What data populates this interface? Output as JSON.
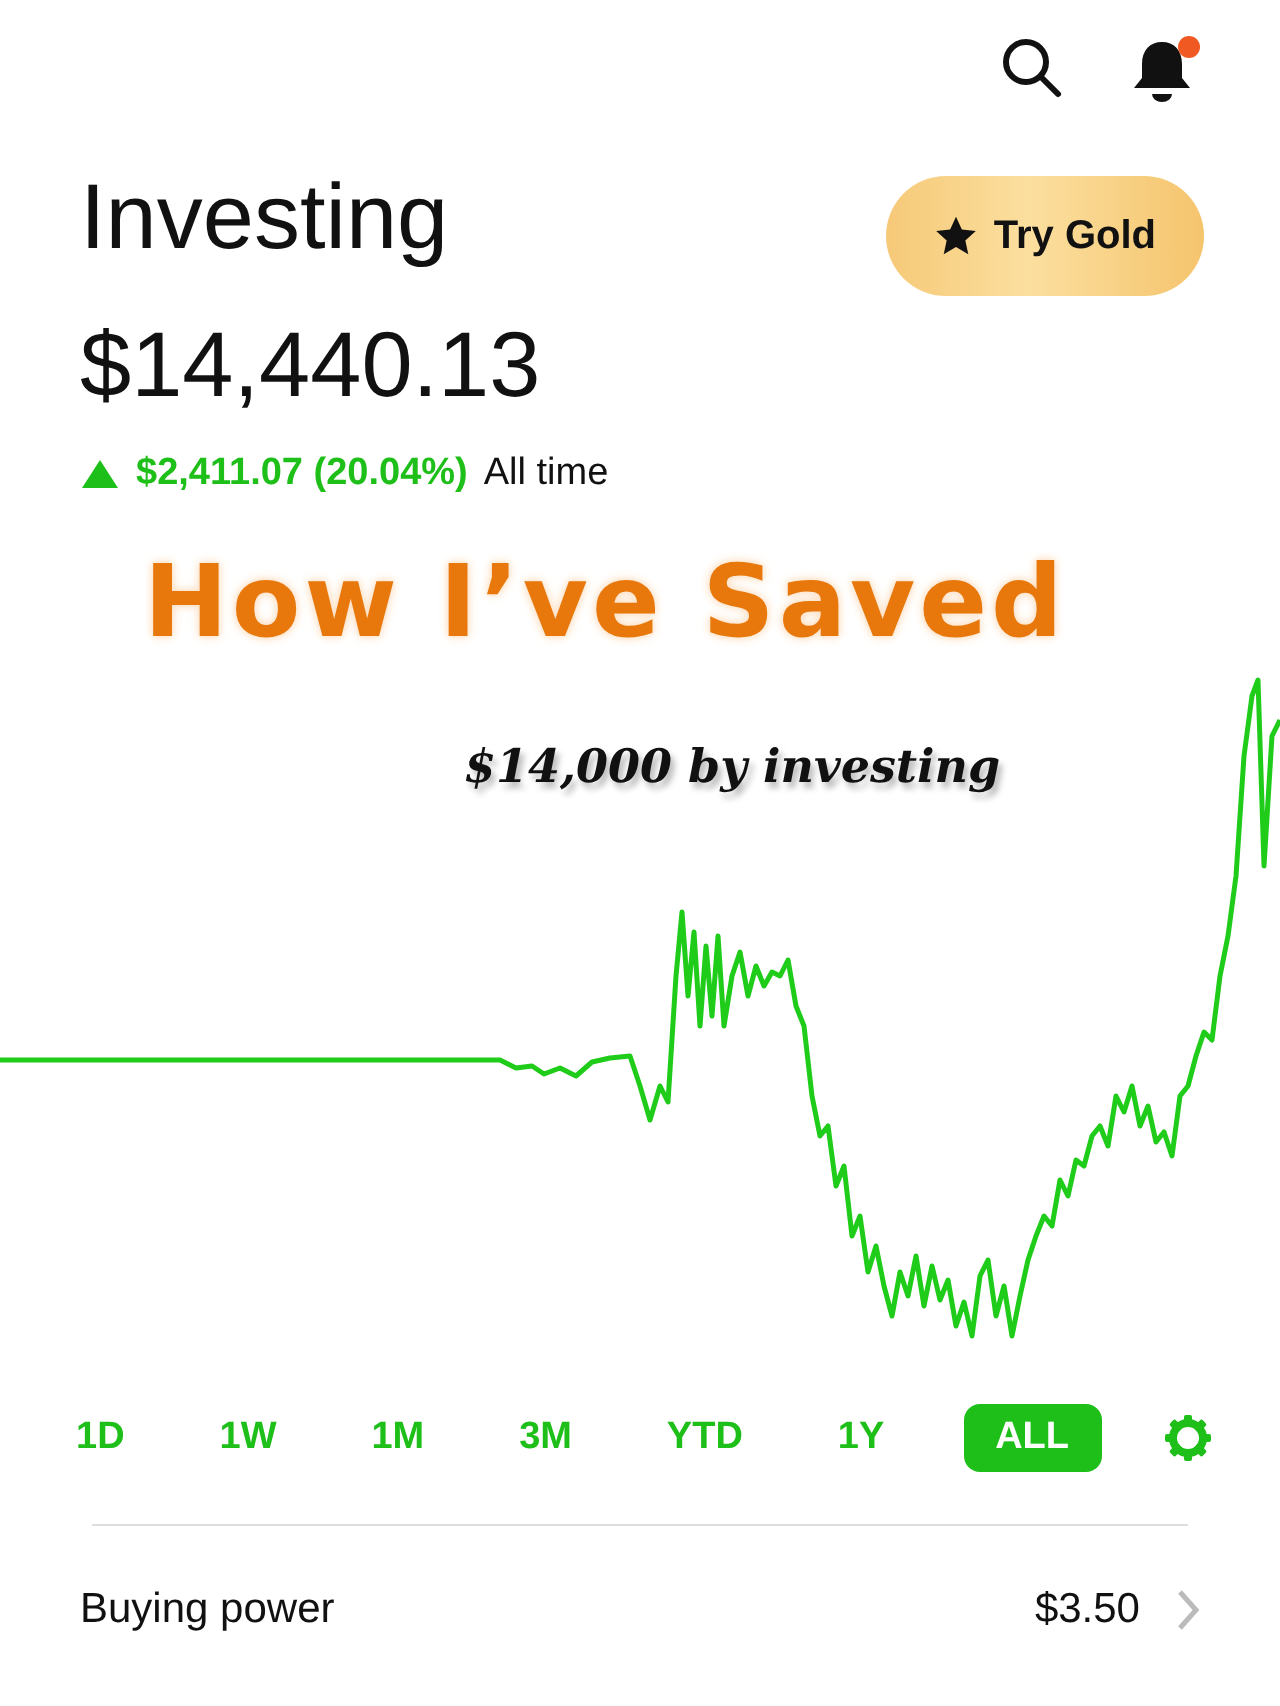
{
  "header": {
    "gold_button": "Try Gold",
    "notification_badge": true
  },
  "portfolio": {
    "title": "Investing",
    "balance": "$14,440.13",
    "change": {
      "rising": true,
      "amount": "$2,411.07 (20.04%)",
      "period": "All time"
    }
  },
  "overlay": {
    "headline": "How I’ve Saved",
    "subline": "$14,000 by investing"
  },
  "ranges": [
    {
      "label": "1D",
      "selected": false
    },
    {
      "label": "1W",
      "selected": false
    },
    {
      "label": "1M",
      "selected": false
    },
    {
      "label": "3M",
      "selected": false
    },
    {
      "label": "YTD",
      "selected": false
    },
    {
      "label": "1Y",
      "selected": false
    },
    {
      "label": "ALL",
      "selected": true
    }
  ],
  "buying_power": {
    "label": "Buying power",
    "value": "$3.50"
  }
}
